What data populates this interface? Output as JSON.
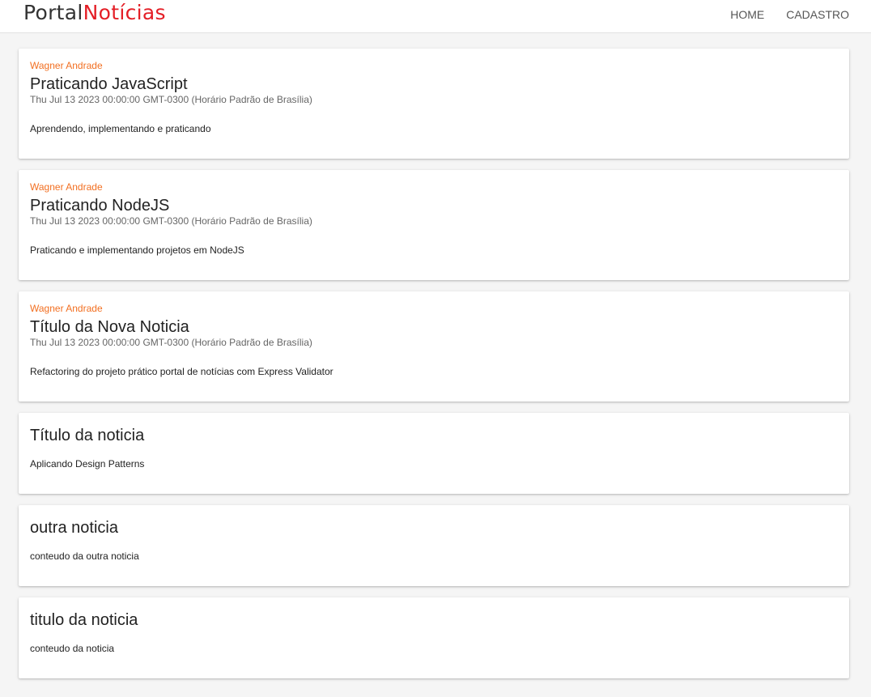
{
  "header": {
    "brand_part1": "Portal",
    "brand_part2": "Notícias",
    "nav": [
      {
        "label": "HOME"
      },
      {
        "label": "CADASTRO"
      }
    ]
  },
  "colors": {
    "author": "#f26f21",
    "brand_accent": "#e41e26"
  },
  "posts": [
    {
      "author": "Wagner Andrade",
      "title": "Praticando JavaScript",
      "date": "Thu Jul 13 2023 00:00:00 GMT-0300 (Horário Padrão de Brasília)",
      "content": "Aprendendo, implementando e praticando"
    },
    {
      "author": "Wagner Andrade",
      "title": "Praticando NodeJS",
      "date": "Thu Jul 13 2023 00:00:00 GMT-0300 (Horário Padrão de Brasília)",
      "content": "Praticando e implementando projetos em NodeJS"
    },
    {
      "author": "Wagner Andrade",
      "title": "Título da Nova Noticia",
      "date": "Thu Jul 13 2023 00:00:00 GMT-0300 (Horário Padrão de Brasília)",
      "content": "Refactoring do projeto prático portal de notícias com Express Validator"
    },
    {
      "title": "Título da noticia",
      "content": "Aplicando Design Patterns"
    },
    {
      "title": "outra noticia",
      "content": "conteudo da outra noticia"
    },
    {
      "title": "titulo da noticia",
      "content": "conteudo da noticia"
    }
  ]
}
